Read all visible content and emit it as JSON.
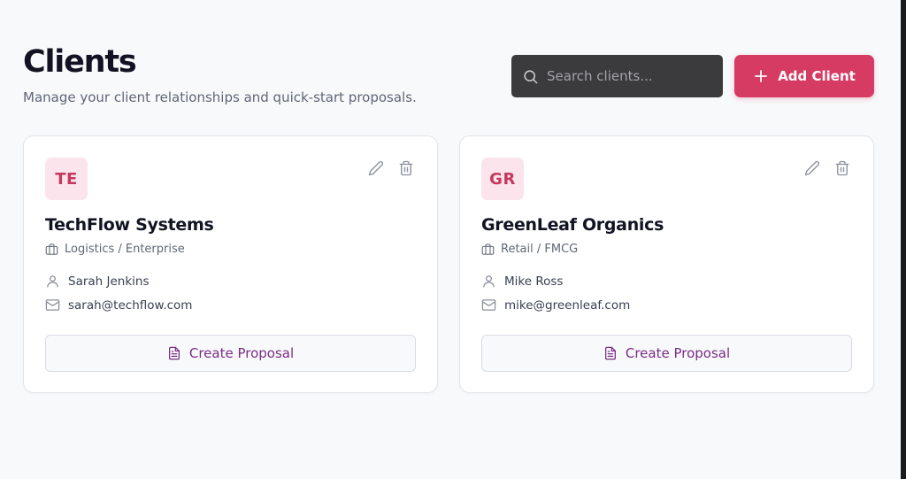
{
  "header": {
    "title": "Clients",
    "subtitle": "Manage your client relationships and quick-start proposals."
  },
  "search": {
    "placeholder": "Search clients..."
  },
  "add_client": {
    "label": "Add Client"
  },
  "clients": [
    {
      "initials": "TE",
      "name": "TechFlow Systems",
      "industry": "Logistics / Enterprise",
      "contact": "Sarah Jenkins",
      "email": "sarah@techflow.com",
      "action_label": "Create Proposal"
    },
    {
      "initials": "GR",
      "name": "GreenLeaf Organics",
      "industry": "Retail / FMCG",
      "contact": "Mike Ross",
      "email": "mike@greenleaf.com",
      "action_label": "Create Proposal"
    }
  ],
  "icons": {
    "search": "search-icon",
    "add": "plus-icon",
    "edit": "pencil-icon",
    "delete": "trash-icon",
    "industry": "briefcase-icon",
    "contact": "user-icon",
    "email": "mail-icon",
    "proposal": "document-icon"
  },
  "colors": {
    "accent": "#d63b64",
    "avatar_bg": "#fbe4ec",
    "avatar_text": "#c43a5f",
    "proposal_text": "#7a2d86",
    "search_bg": "#3b3b3d",
    "page_bg": "#f8f9fb"
  }
}
